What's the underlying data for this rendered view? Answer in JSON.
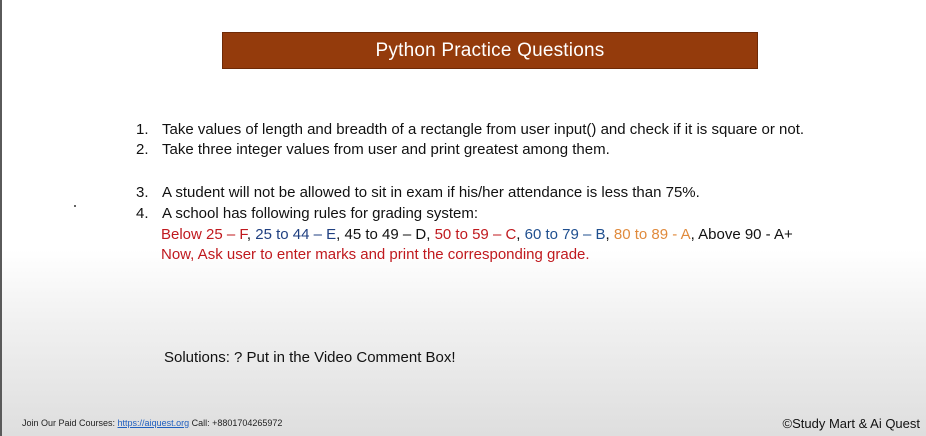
{
  "slide": {
    "title": "Python Practice Questions",
    "questions": [
      {
        "number": "1.",
        "text": "Take values of length and breadth of a rectangle from user input() and check if it is square or not."
      },
      {
        "number": "2.",
        "text": "Take three integer values from user and print greatest among them."
      },
      {
        "number": "3.",
        "text": "A student will not be allowed to sit in exam if his/her attendance is less than 75%."
      },
      {
        "number": "4.",
        "text": "A school has following rules for grading system:"
      }
    ],
    "grades": [
      {
        "text": "Below 25 – F",
        "color": "#c0191e"
      },
      {
        "text": ", ",
        "color": "#111111"
      },
      {
        "text": "25 to 44 – E",
        "color": "#1f3f80"
      },
      {
        "text": ", ",
        "color": "#111111"
      },
      {
        "text": "45 to 49 – D",
        "color": "#111111"
      },
      {
        "text": ", ",
        "color": "#111111"
      },
      {
        "text": "50 to 59 – C",
        "color": "#c0191e"
      },
      {
        "text": ", ",
        "color": "#111111"
      },
      {
        "text": "60 to 79 – B",
        "color": "#1f4f8f"
      },
      {
        "text": ", ",
        "color": "#111111"
      },
      {
        "text": "80 to 89 - A",
        "color": "#e08a3c"
      },
      {
        "text": ", Above 90 - A+",
        "color": "#111111"
      }
    ],
    "instruction": "Now, Ask user to enter marks and print the corresponding grade.",
    "instruction_color": "#c0191e",
    "solutions": "Solutions: ? Put in the Video Comment Box!"
  },
  "footer": {
    "courses_label": "Join Our Paid Courses: ",
    "courses_link": "https://aiquest.org",
    "call_label": "  Call: +8801704265972",
    "copyright": "©Study Mart & Ai Quest"
  },
  "colors": {
    "title_bar": "#943b0c",
    "title_text": "#ffffff"
  }
}
